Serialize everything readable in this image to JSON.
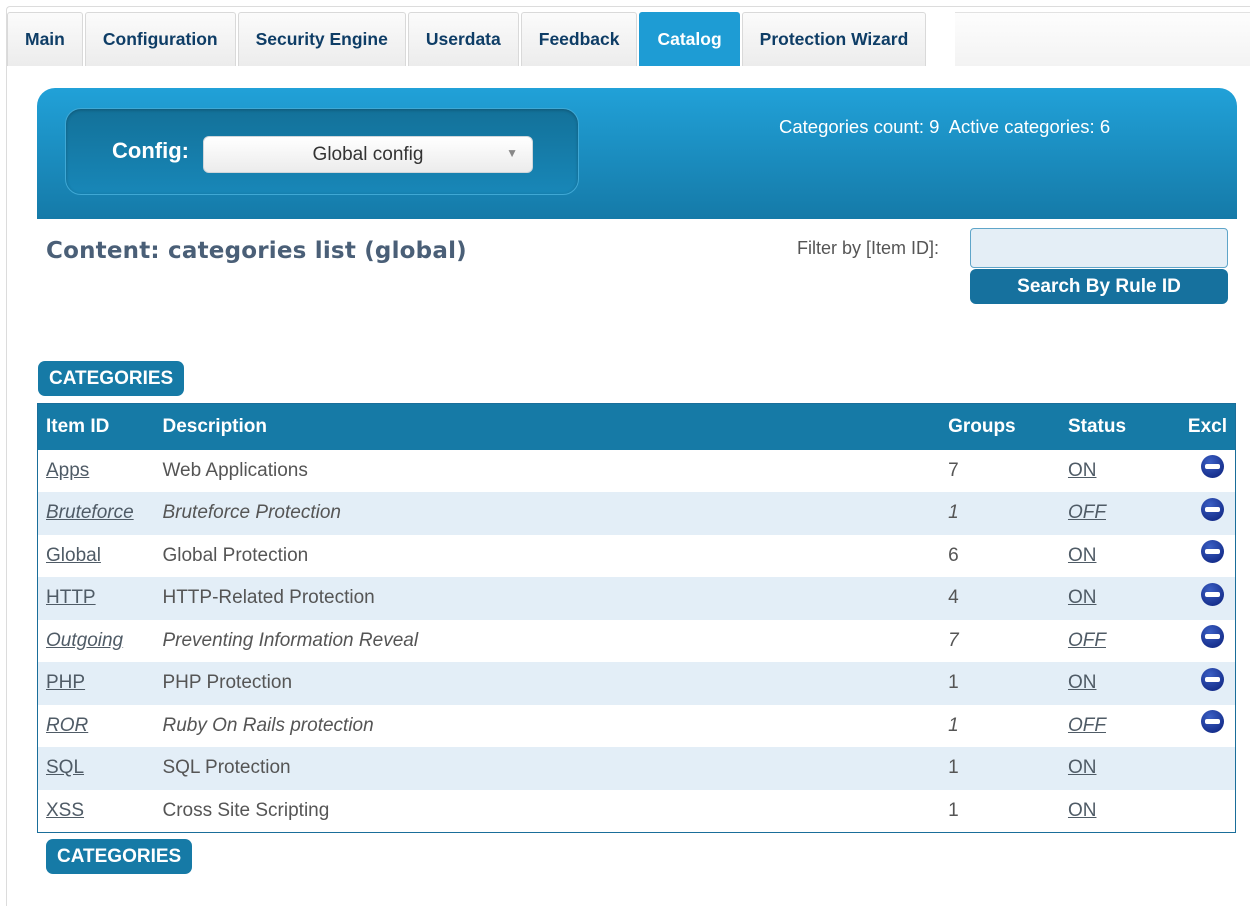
{
  "tabs": [
    {
      "label": "Main",
      "active": false
    },
    {
      "label": "Configuration",
      "active": false
    },
    {
      "label": "Security Engine",
      "active": false
    },
    {
      "label": "Userdata",
      "active": false
    },
    {
      "label": "Feedback",
      "active": false
    },
    {
      "label": "Catalog",
      "active": true
    },
    {
      "label": "Protection Wizard",
      "active": false
    }
  ],
  "banner": {
    "config_label": "Config:",
    "config_selected": "Global config",
    "stats": "Categories count: 9  Active categories: 6"
  },
  "content": {
    "title": "Content: categories list (global)",
    "filter_label": "Filter by [Item ID]:",
    "filter_value": "",
    "search_button": "Search By Rule ID",
    "section_label_top": "CATEGORIES",
    "section_label_bottom": "CATEGORIES"
  },
  "table": {
    "headers": {
      "id": "Item ID",
      "description": "Description",
      "groups": "Groups",
      "status": "Status",
      "excl": "Excl"
    },
    "rows": [
      {
        "id": "Apps",
        "description": "Web Applications",
        "groups": "7",
        "status": "ON",
        "excl": true
      },
      {
        "id": "Bruteforce",
        "description": "Bruteforce Protection",
        "groups": "1",
        "status": "OFF",
        "excl": true
      },
      {
        "id": "Global",
        "description": "Global Protection",
        "groups": "6",
        "status": "ON",
        "excl": true
      },
      {
        "id": "HTTP",
        "description": "HTTP-Related Protection",
        "groups": "4",
        "status": "ON",
        "excl": true
      },
      {
        "id": "Outgoing",
        "description": "Preventing Information Reveal",
        "groups": "7",
        "status": "OFF",
        "excl": true
      },
      {
        "id": "PHP",
        "description": "PHP Protection",
        "groups": "1",
        "status": "ON",
        "excl": true
      },
      {
        "id": "ROR",
        "description": "Ruby On Rails protection",
        "groups": "1",
        "status": "OFF",
        "excl": true
      },
      {
        "id": "SQL",
        "description": "SQL Protection",
        "groups": "1",
        "status": "ON",
        "excl": false
      },
      {
        "id": "XSS",
        "description": "Cross Site Scripting",
        "groups": "1",
        "status": "ON",
        "excl": false
      }
    ]
  },
  "icons": {
    "excl": "exclude-minus-circle-icon",
    "select_arrow": "dropdown-arrow-icon"
  },
  "colors": {
    "accent": "#1e9cd4",
    "header": "#167aa6",
    "row_alt": "#e3eef7",
    "tab_text": "#0e3d66"
  }
}
